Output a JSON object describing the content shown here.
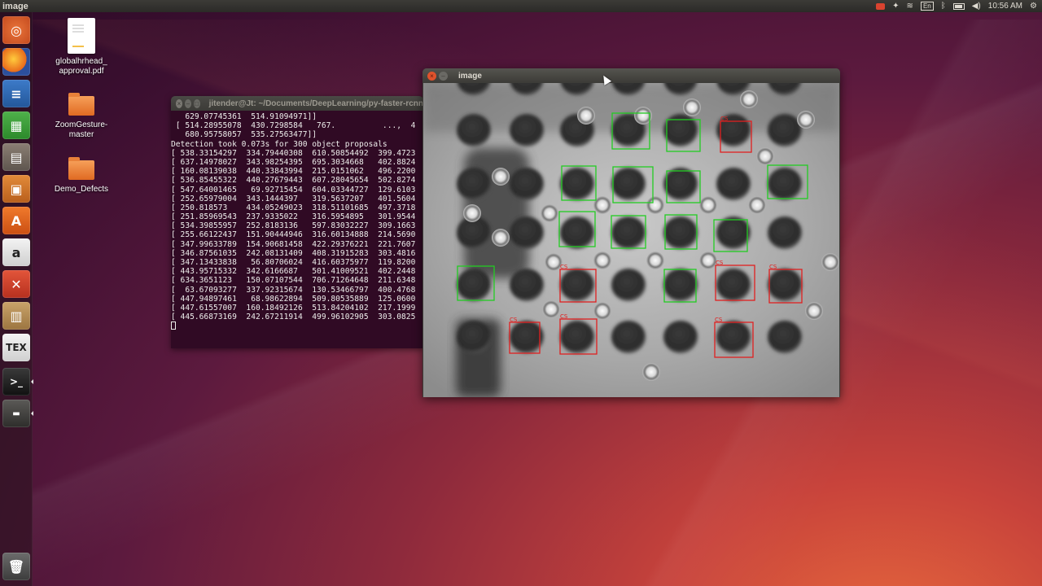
{
  "top_panel": {
    "app_title": "image",
    "keyboard_layout": "En",
    "time": "10:56 AM",
    "tray_icons": [
      "record-icon",
      "dropbox-icon",
      "bluetooth-icon",
      "battery-icon",
      "volume-icon",
      "power-gear-icon"
    ]
  },
  "launcher": {
    "items": [
      "ubuntu-dash",
      "firefox",
      "libreoffice-writer",
      "libreoffice-calc",
      "files",
      "libreoffice-impress",
      "software-center",
      "amazon",
      "system-settings",
      "archive-manager",
      "texmaker",
      "terminal",
      "workspace-switcher",
      "trash"
    ]
  },
  "desktop_icons": [
    {
      "name": "globalhrhead_\napproval.pdf",
      "type": "pdf"
    },
    {
      "name": "ZoomGesture-\nmaster",
      "type": "folder"
    },
    {
      "name": "Demo_Defects",
      "type": "folder"
    }
  ],
  "terminal": {
    "title": "jitender@Jt: ~/Documents/DeepLearning/py-faster-rcnn",
    "lines": [
      "   629.07745361  514.91094971]]",
      " [ 514.28955078  430.7298584   767.          ...,  4",
      "   680.95758057  535.27563477]]",
      "Detection took 0.073s for 300 object proposals",
      "[ 538.33154297  334.79440308  610.50854492  399.4723",
      "[ 637.14978027  343.98254395  695.3034668   402.8824",
      "[ 160.08139038  440.33843994  215.0151062   496.2200",
      "[ 536.85455322  440.27679443  607.28045654  502.8274",
      "[ 547.64001465   69.92715454  604.03344727  129.6103",
      "[ 252.65979004  343.1444397   319.5637207   401.5604",
      "[ 250.818573    434.05249023  318.51101685  497.3718",
      "[ 251.85969543  237.9335022   316.5954895   301.9544",
      "[ 534.39855957  252.8183136   597.83032227  309.1663",
      "[ 255.66122437  151.90444946  316.60134888  214.5690",
      "[ 347.99633789  154.90681458  422.29376221  221.7607",
      "[ 346.87561035  242.08131409  408.31915283  303.4816",
      "[ 347.13433838   56.80706024  416.60375977  119.8200",
      "[ 443.95715332  342.6166687   501.41009521  402.2448",
      "[ 634.3651123   150.07107544  706.71264648  211.6348",
      "[  63.67093277  337.92315674  130.53466797  400.4768",
      "[ 447.94897461   68.98622894  509.80535889  125.0600",
      "[ 447.61557007  160.18492126  513.84204102  217.1999",
      "[ 445.66873169  242.67211914  499.96102905  303.0825"
    ]
  },
  "image_window": {
    "title": "image",
    "defect_label": "CS"
  },
  "colors": {
    "good_box": "#22cc22",
    "defect_box": "#e02020",
    "terminal_bg": "#300a24"
  }
}
